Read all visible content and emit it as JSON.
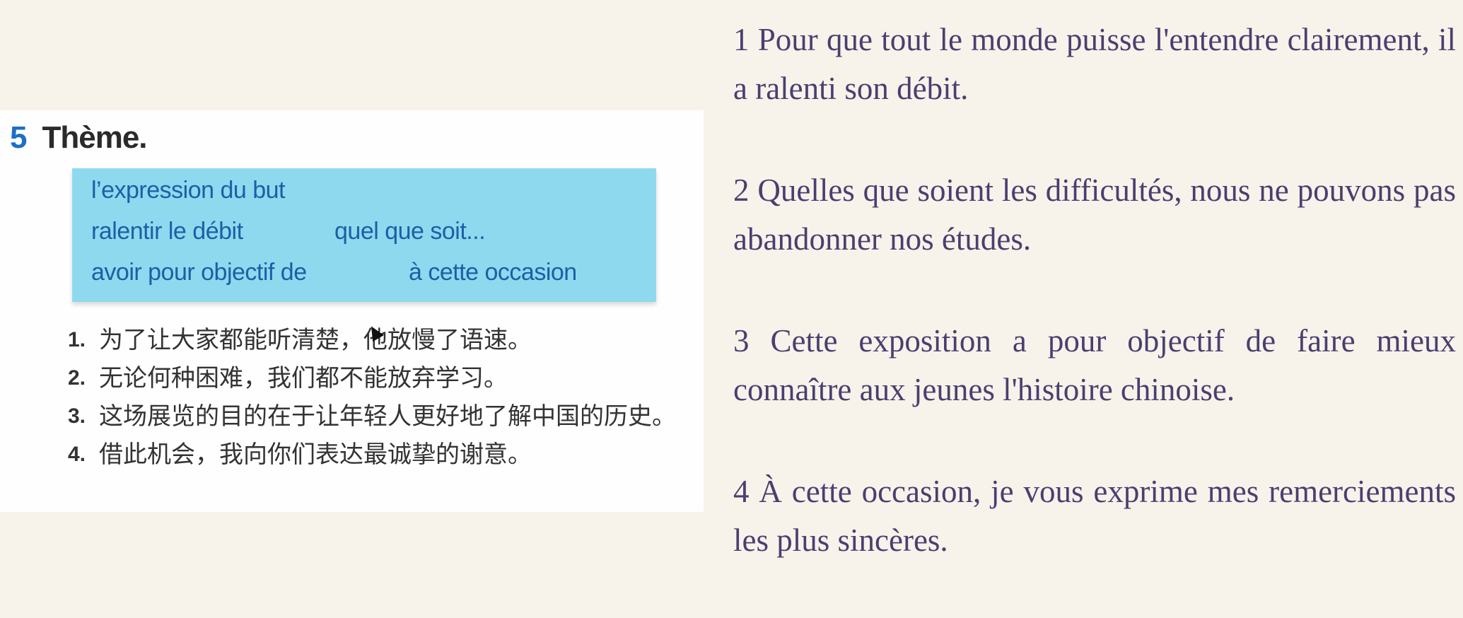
{
  "exercise": {
    "number": "5",
    "title": "Thème.",
    "vocab_box": [
      "l’expression du but",
      "ralentir le débit",
      "quel que soit...",
      "avoir pour objectif de",
      "à cette occasion"
    ],
    "sentences": [
      {
        "num": "1.",
        "text": "为了让大家都能听清楚，他放慢了语速。"
      },
      {
        "num": "2.",
        "text": "无论何种困难，我们都不能放弃学习。"
      },
      {
        "num": "3.",
        "text": "这场展览的目的在于让年轻人更好地了解中国的历史。"
      },
      {
        "num": "4.",
        "text": "借此机会，我向你们表达最诚挚的谢意。"
      }
    ]
  },
  "answers": [
    "1 Pour que tout le monde puisse l'entendre clairement, il a ralenti son débit.",
    "2 Quelles que soient les difficultés, nous ne pouvons pas abandonner nos études.",
    "3 Cette exposition a pour objectif de faire mieux connaître aux jeunes l'histoire chinoise.",
    "4 À cette occasion, je vous exprime mes remerciements les plus sincères."
  ],
  "colors": {
    "background": "#f8f3ea",
    "box": "#8fd9ef",
    "box_text": "#1d5fa6",
    "answer_text": "#4a3f70"
  }
}
